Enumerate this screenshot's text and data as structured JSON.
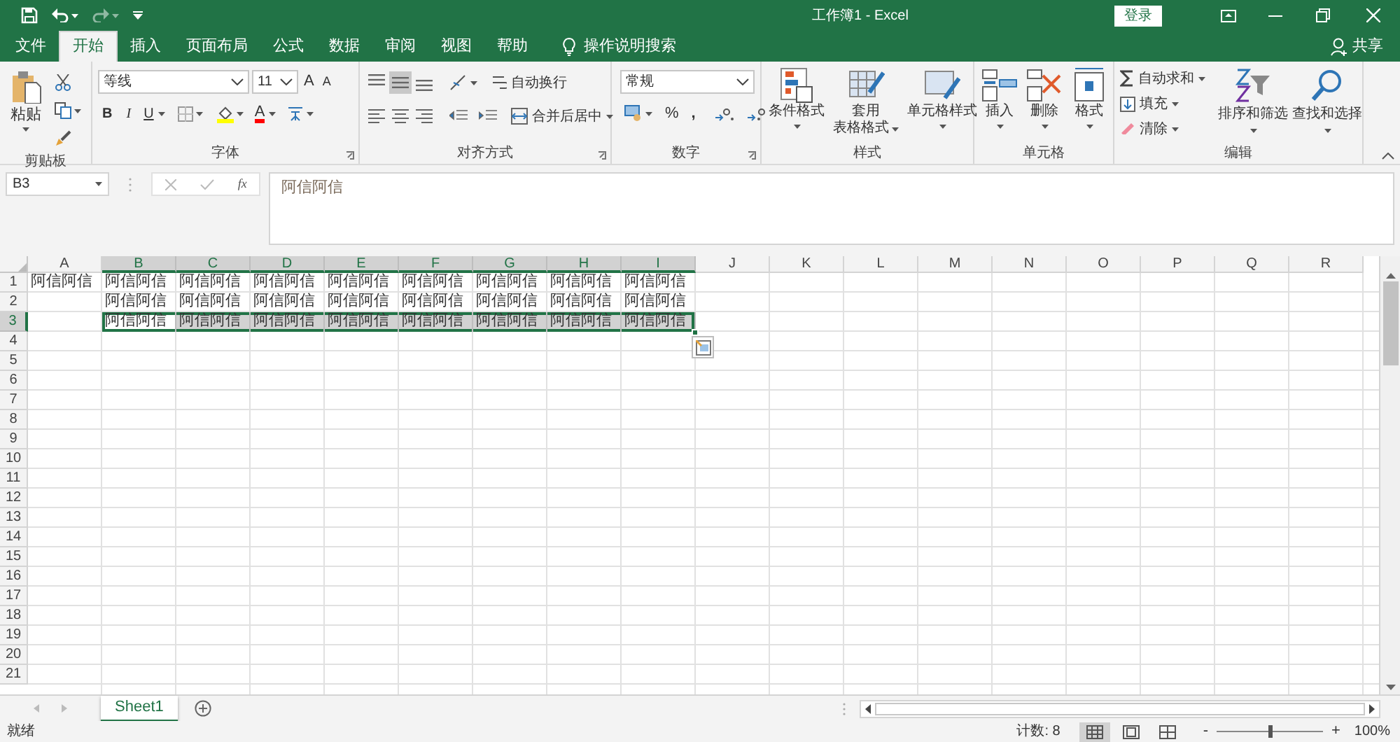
{
  "window": {
    "title": "工作簿1  -  Excel",
    "login": "登录"
  },
  "quick_access": [
    {
      "kind": "save",
      "disabled": false
    },
    {
      "kind": "undo",
      "disabled": false
    },
    {
      "kind": "redo",
      "disabled": true
    },
    {
      "kind": "customize",
      "disabled": false
    }
  ],
  "menu_tabs": [
    {
      "label": "文件",
      "selected": false
    },
    {
      "label": "开始",
      "selected": true
    },
    {
      "label": "插入",
      "selected": false
    },
    {
      "label": "页面布局",
      "selected": false
    },
    {
      "label": "公式",
      "selected": false
    },
    {
      "label": "数据",
      "selected": false
    },
    {
      "label": "审阅",
      "selected": false
    },
    {
      "label": "视图",
      "selected": false
    },
    {
      "label": "帮助",
      "selected": false
    }
  ],
  "tell_me": "操作说明搜索",
  "share": "共享",
  "ribbon": [
    {
      "kind": "clipboard",
      "label": "剪贴板",
      "paste": "粘贴"
    },
    {
      "kind": "font",
      "label": "字体",
      "font_name": "等线",
      "font_size": "11",
      "grow": "A",
      "shrink": "A",
      "bold": "B",
      "italic": "I",
      "underline": "U",
      "font_color": "A"
    },
    {
      "kind": "alignment",
      "label": "对齐方式",
      "vertical": [
        {
          "selected": false
        },
        {
          "selected": true
        },
        {
          "selected": false
        }
      ],
      "wrap_text": "自动换行",
      "merge": "合并后居中"
    },
    {
      "kind": "number",
      "label": "数字",
      "format": "常规",
      "percent": "%",
      "comma": ","
    },
    {
      "kind": "styles",
      "label": "样式",
      "buttons": [
        {
          "lines": [
            "条件格式"
          ]
        },
        {
          "lines": [
            "套用",
            "表格格式"
          ]
        },
        {
          "lines": [
            "单元格样式"
          ]
        }
      ]
    },
    {
      "kind": "cells",
      "label": "单元格",
      "buttons": [
        {
          "lines": [
            "插入"
          ]
        },
        {
          "lines": [
            "删除"
          ]
        },
        {
          "lines": [
            "格式"
          ]
        }
      ]
    },
    {
      "kind": "editing",
      "label": "编辑",
      "autosum": "自动求和",
      "fill": "填充",
      "clear": "清除",
      "sort": "排序和筛选",
      "find": "查找和选择"
    }
  ],
  "formula_bar": {
    "name_box": "B3",
    "fx": "fx",
    "formula": "阿信阿信"
  },
  "columns": [
    {
      "label": "A",
      "selected": false
    },
    {
      "label": "B",
      "selected": true
    },
    {
      "label": "C",
      "selected": true
    },
    {
      "label": "D",
      "selected": true
    },
    {
      "label": "E",
      "selected": true
    },
    {
      "label": "F",
      "selected": true
    },
    {
      "label": "G",
      "selected": true
    },
    {
      "label": "H",
      "selected": true
    },
    {
      "label": "I",
      "selected": true
    },
    {
      "label": "J",
      "selected": false
    },
    {
      "label": "K",
      "selected": false
    },
    {
      "label": "L",
      "selected": false
    },
    {
      "label": "M",
      "selected": false
    },
    {
      "label": "N",
      "selected": false
    },
    {
      "label": "O",
      "selected": false
    },
    {
      "label": "P",
      "selected": false
    },
    {
      "label": "Q",
      "selected": false
    },
    {
      "label": "R",
      "selected": false
    }
  ],
  "rows": [
    {
      "label": "1",
      "selected": false,
      "cells": [
        {
          "text": "阿信阿信",
          "selected": false
        },
        {
          "text": "阿信阿信",
          "selected": false
        },
        {
          "text": "阿信阿信",
          "selected": false
        },
        {
          "text": "阿信阿信",
          "selected": false
        },
        {
          "text": "阿信阿信",
          "selected": false
        },
        {
          "text": "阿信阿信",
          "selected": false
        },
        {
          "text": "阿信阿信",
          "selected": false
        },
        {
          "text": "阿信阿信",
          "selected": false
        },
        {
          "text": "阿信阿信",
          "selected": false
        }
      ]
    },
    {
      "label": "2",
      "selected": false,
      "cells": [
        {
          "selected": false
        },
        {
          "text": "阿信阿信",
          "selected": false
        },
        {
          "text": "阿信阿信",
          "selected": false
        },
        {
          "text": "阿信阿信",
          "selected": false
        },
        {
          "text": "阿信阿信",
          "selected": false
        },
        {
          "text": "阿信阿信",
          "selected": false
        },
        {
          "text": "阿信阿信",
          "selected": false
        },
        {
          "text": "阿信阿信",
          "selected": false
        },
        {
          "text": "阿信阿信",
          "selected": false
        }
      ]
    },
    {
      "label": "3",
      "selected": true,
      "cells": [
        {
          "selected": false
        },
        {
          "text": "阿信阿信",
          "selected": true,
          "active": true
        },
        {
          "text": "阿信阿信",
          "selected": true,
          "active": false
        },
        {
          "text": "阿信阿信",
          "selected": true,
          "active": false
        },
        {
          "text": "阿信阿信",
          "selected": true,
          "active": false
        },
        {
          "text": "阿信阿信",
          "selected": true,
          "active": false
        },
        {
          "text": "阿信阿信",
          "selected": true,
          "active": false
        },
        {
          "text": "阿信阿信",
          "selected": true,
          "active": false
        },
        {
          "text": "阿信阿信",
          "selected": true,
          "active": false
        }
      ]
    },
    {
      "label": "4",
      "selected": false
    },
    {
      "label": "5",
      "selected": false
    },
    {
      "label": "6",
      "selected": false
    },
    {
      "label": "7",
      "selected": false
    },
    {
      "label": "8",
      "selected": false
    },
    {
      "label": "9",
      "selected": false
    },
    {
      "label": "10",
      "selected": false
    },
    {
      "label": "11",
      "selected": false
    },
    {
      "label": "12",
      "selected": false
    },
    {
      "label": "13",
      "selected": false
    },
    {
      "label": "14",
      "selected": false
    },
    {
      "label": "15",
      "selected": false
    },
    {
      "label": "16",
      "selected": false
    },
    {
      "label": "17",
      "selected": false
    },
    {
      "label": "18",
      "selected": false
    },
    {
      "label": "19",
      "selected": false
    },
    {
      "label": "20",
      "selected": false
    },
    {
      "label": "21",
      "selected": false
    }
  ],
  "sheet_tabs": [
    {
      "label": "Sheet1",
      "selected": true
    }
  ],
  "status_bar": {
    "status": "就绪",
    "count": "计数: 8",
    "views": [
      {
        "kind": "normal",
        "selected": true
      },
      {
        "kind": "page_layout",
        "selected": false
      },
      {
        "kind": "page_break",
        "selected": false
      }
    ],
    "zoom_out": "-",
    "zoom_in": "+",
    "zoom": {
      "level": 0.5
    },
    "zoom_text": "100%"
  }
}
